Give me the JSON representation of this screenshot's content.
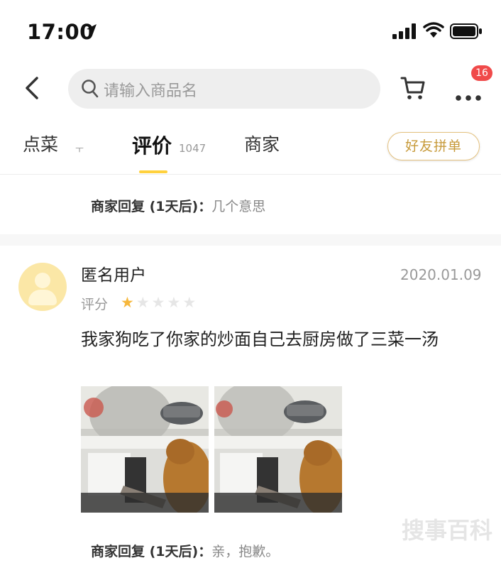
{
  "status_bar": {
    "time": "17:00"
  },
  "nav": {
    "search_placeholder": "请输入商品名",
    "cart_badge": "16"
  },
  "tabs": {
    "order": "点菜",
    "order_arrow": "ㅜ",
    "reviews": "评价",
    "reviews_count": "1047",
    "merchant": "商家",
    "group_order": "好友拼单"
  },
  "previous_review": {
    "reply_label": "商家回复 (1天后)：",
    "reply_text": "几个意思"
  },
  "review": {
    "user_name": "匿名用户",
    "date": "2020.01.09",
    "rating_label": "评分",
    "rating": 1,
    "rating_max": 5,
    "text": "我家狗吃了你家的炒面自己去厨房做了三菜一汤",
    "reply_label": "商家回复 (1天后)：",
    "reply_text": "亲，抱歉。"
  },
  "watermark": "搜事百科",
  "colors": {
    "accent_yellow": "#ffd13d",
    "badge_red": "#f04a4a",
    "star_gold": "#f6b73c",
    "group_button_text": "#c79a3a"
  }
}
